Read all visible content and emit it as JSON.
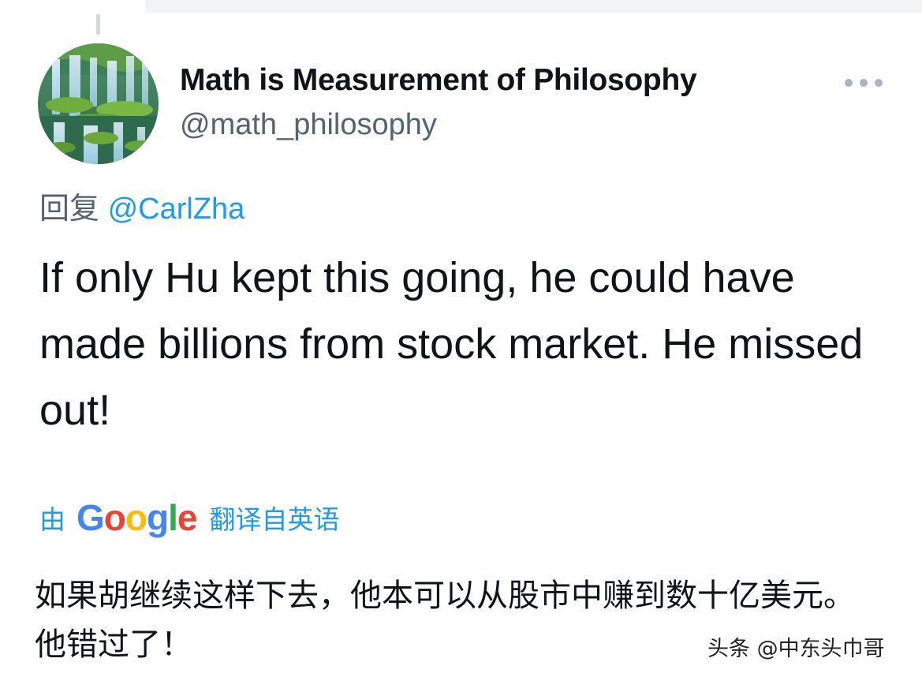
{
  "tweet": {
    "author": {
      "display_name": "Math is Measurement of Philosophy",
      "handle": "@math_philosophy",
      "avatar": "waterfall-photo"
    },
    "more_icon": "more-horizontal-icon",
    "reply_prefix": "回复",
    "reply_mention": "@CarlZha",
    "text": "If only Hu kept this going, he could have made billions from stock market. He missed out!",
    "translation": {
      "prefix": "由",
      "provider": "Google",
      "provider_letters": [
        "G",
        "o",
        "o",
        "g",
        "l",
        "e"
      ],
      "suffix": "翻译自英语",
      "text": "如果胡继续这样下去，他本可以从股市中赚到数十亿美元。他错过了！"
    }
  },
  "watermark": "头条 @中东头巾哥",
  "colors": {
    "text_primary": "#0f1419",
    "text_secondary": "#536471",
    "link": "#1d9bf0",
    "google_blue": "#4285f4",
    "google_red": "#ea4335",
    "google_yellow": "#fbbc05",
    "google_green": "#34a853"
  }
}
